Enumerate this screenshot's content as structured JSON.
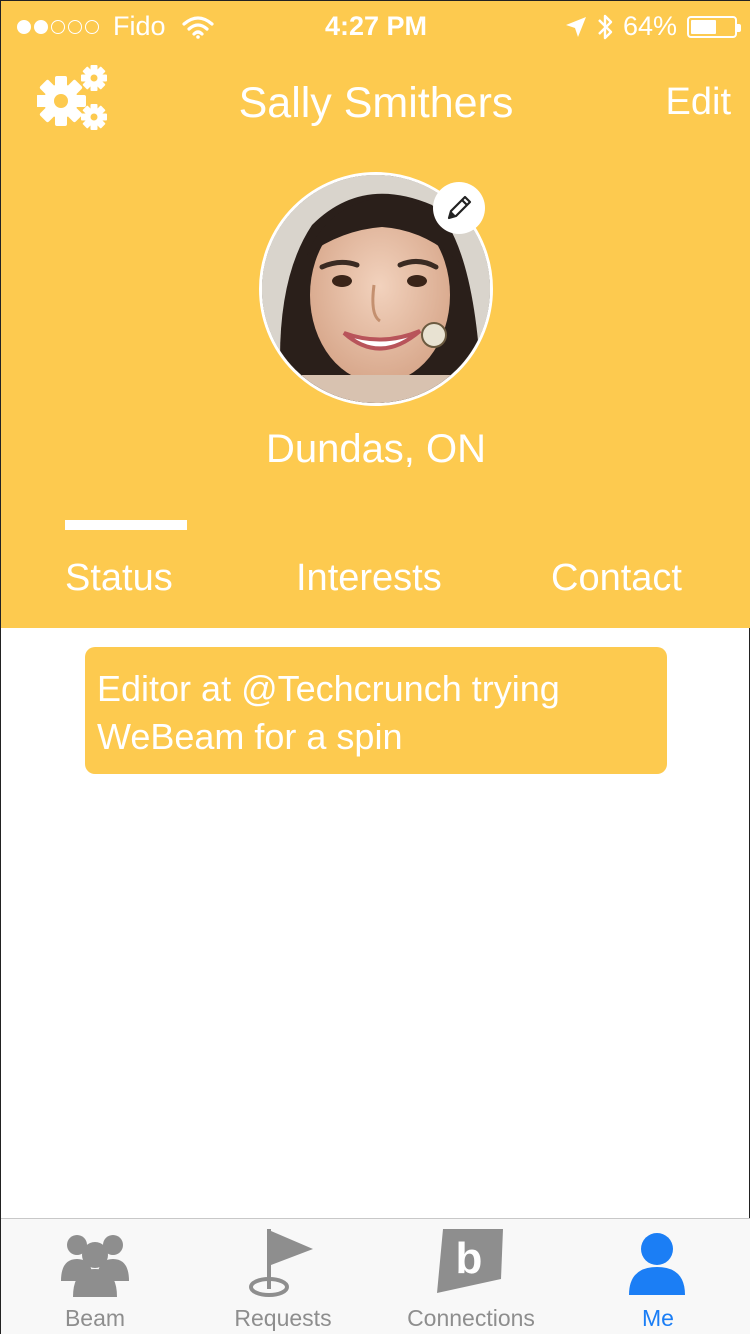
{
  "status_bar": {
    "carrier": "Fido",
    "signal_filled": 2,
    "signal_total": 5,
    "time": "4:27 PM",
    "battery": "64%",
    "battery_level": 0.64
  },
  "nav": {
    "title": "Sally Smithers",
    "edit_label": "Edit",
    "settings_icon": "gears-icon"
  },
  "profile": {
    "location": "Dundas, ON",
    "edit_photo_icon": "pencil-icon"
  },
  "tabs": [
    {
      "label": "Status",
      "active": true
    },
    {
      "label": "Interests",
      "active": false
    },
    {
      "label": "Contact",
      "active": false
    }
  ],
  "status_message": "Editor at @Techcrunch trying WeBeam for a spin",
  "tab_bar": [
    {
      "label": "Beam",
      "icon": "people-icon",
      "active": false
    },
    {
      "label": "Requests",
      "icon": "flag-icon",
      "active": false
    },
    {
      "label": "Connections",
      "icon": "b-logo-icon",
      "active": false
    },
    {
      "label": "Me",
      "icon": "person-icon",
      "active": true
    }
  ],
  "colors": {
    "accent": "#fdca4f",
    "active_tab": "#1b7ef5",
    "inactive_tab": "#8e8e8e"
  }
}
